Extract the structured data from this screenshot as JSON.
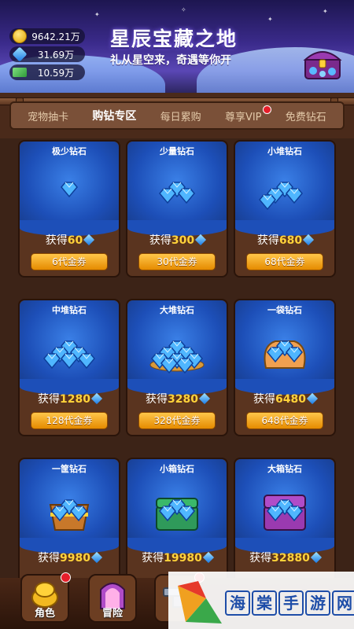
{
  "header": {
    "title": "星辰宝藏之地",
    "subtitle": "礼从星空来，奇遇等你开",
    "currencies": [
      {
        "icon": "gold-coin-icon",
        "value": "9642.21万"
      },
      {
        "icon": "diamond-icon",
        "value": "31.69万"
      },
      {
        "icon": "cash-icon",
        "value": "10.59万"
      }
    ]
  },
  "tabs": [
    {
      "label": "宠物抽卡",
      "active": false
    },
    {
      "label": "购钻专区",
      "active": true
    },
    {
      "label": "每日累购",
      "active": false
    },
    {
      "label": "尊享VIP",
      "active": false,
      "badge": true
    },
    {
      "label": "免费钻石",
      "active": false
    }
  ],
  "packs": [
    {
      "name": "极少钻石",
      "prefix": "获得",
      "amount": "60",
      "price": "6代金券",
      "art": "diamond-small"
    },
    {
      "name": "少量钻石",
      "prefix": "获得",
      "amount": "300",
      "price": "30代金券",
      "art": "diamond-few"
    },
    {
      "name": "小堆钻石",
      "prefix": "获得",
      "amount": "680",
      "price": "68代金券",
      "art": "diamond-pile-small"
    },
    {
      "name": "中堆钻石",
      "prefix": "获得",
      "amount": "1280",
      "price": "128代金券",
      "art": "diamond-pile-medium"
    },
    {
      "name": "大堆钻石",
      "prefix": "获得",
      "amount": "3280",
      "price": "328代金券",
      "art": "diamond-pile-large"
    },
    {
      "name": "一袋钻石",
      "prefix": "获得",
      "amount": "6480",
      "price": "648代金券",
      "art": "diamond-bag"
    },
    {
      "name": "一筐钻石",
      "prefix": "获得",
      "amount": "9980",
      "price": "",
      "art": "diamond-basket"
    },
    {
      "name": "小箱钻石",
      "prefix": "获得",
      "amount": "19980",
      "price": "",
      "art": "diamond-chest-small"
    },
    {
      "name": "大箱钻石",
      "prefix": "获得",
      "amount": "32880",
      "price": "",
      "art": "diamond-chest-large"
    }
  ],
  "bottom_nav": [
    {
      "label": "角色",
      "icon": "character-icon",
      "badge": true
    },
    {
      "label": "冒险",
      "icon": "adventure-icon",
      "badge": false
    },
    {
      "label": "",
      "icon": "anvil-icon",
      "badge": true
    }
  ],
  "watermark": {
    "chars": [
      "海",
      "棠",
      "手",
      "游",
      "网"
    ]
  },
  "colors": {
    "accent_gold": "#ffd23a",
    "button_orange": "#f0a020",
    "panel_blue": "#1d4fb8",
    "frame_brown": "#5a341f",
    "badge_red": "#e61e2a"
  }
}
